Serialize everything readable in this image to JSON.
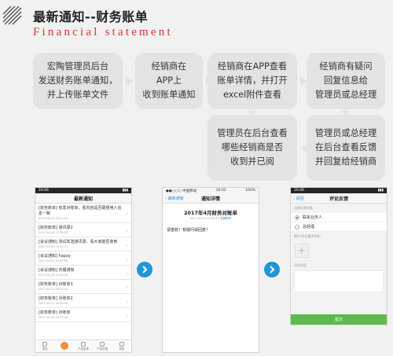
{
  "header": {
    "title": "最新通知--财务账单",
    "subtitle": "Financial statement",
    "accent_color": "#e03030",
    "icon": "diagonal-stripes-icon"
  },
  "flow": {
    "box1": "宏陶管理员后台\n发送财务账单通知，\n并上传账单文件",
    "box2": "经销商在\nAPP上\n收到账单通知",
    "box3": "经销商在APP查看\n账单详情，并打开\nexcel附件查看",
    "box4": "经销商有疑问\n回复信息给\n管理员或总经理",
    "box5": "管理员在后台查看\n哪些经销商是否\n收到并已阅",
    "box6": "管理员或总经理\n在后台查看反馈\n并回复给经销商"
  },
  "phone1": {
    "status_time": "16:06",
    "title": "最新通知",
    "items": [
      {
        "text": "[财务账单] 有发对账单，看内容是否跟便用人信息一致",
        "time": "2017-04-27 19:11:22"
      },
      {
        "text": "[财务账单] 通讯录2",
        "time": "2017-04-26 17:38:33"
      },
      {
        "text": "[会议通知] 测试发送通讯录，看大家能否收到",
        "time": "2017-04-24 15:32:11"
      },
      {
        "text": "[会议通知] hapay",
        "time": "2017-04-24 15:31:03"
      },
      {
        "text": "[会议通知] 衣服通知",
        "time": "2017-04-23 12:05:40"
      },
      {
        "text": "[财务账单] 对账单3",
        "time": "2017-04-21 18:31:20"
      },
      {
        "text": "[财务账单] 对账单2",
        "time": "2017-04-21 18:30:04"
      },
      {
        "text": "[财务账单] 对账单",
        "time": "2017-04-20 15:20:18"
      }
    ],
    "tabs": [
      "首页",
      "",
      "产品信息",
      "产品列表",
      "我的"
    ],
    "active_tab_color": "#f18d36"
  },
  "phone2": {
    "carrier": "●●○○○ 中国移动",
    "status_time": "16:03",
    "battery": "100%",
    "back_label": "最新通知",
    "title": "通知详情",
    "doc_title": "2017年4月财务对账单",
    "doc_meta": "2017-04-27 15:02:57",
    "doc_link": "查看附件",
    "body": "请查收！有疑问请回复！"
  },
  "phone3": {
    "status_time": "16:06",
    "back_label": "返回",
    "title": "评论反馈",
    "section_label": "选择反馈对象",
    "options": [
      "联系业务人",
      "总经理"
    ],
    "image_label": "图片(评论最多9张)",
    "content_label": "评论内容",
    "submit_label": "提交",
    "submit_color": "#5bbb4a"
  },
  "flow_arrow_color": "#2196d6"
}
